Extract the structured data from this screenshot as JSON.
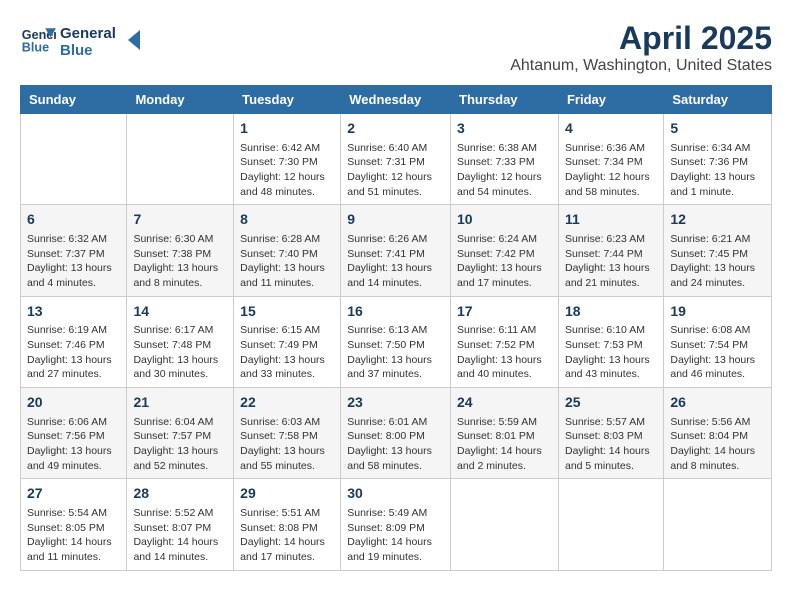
{
  "header": {
    "logo_line1": "General",
    "logo_line2": "Blue",
    "title": "April 2025",
    "subtitle": "Ahtanum, Washington, United States"
  },
  "weekdays": [
    "Sunday",
    "Monday",
    "Tuesday",
    "Wednesday",
    "Thursday",
    "Friday",
    "Saturday"
  ],
  "weeks": [
    [
      {
        "day": "",
        "info": ""
      },
      {
        "day": "",
        "info": ""
      },
      {
        "day": "1",
        "info": "Sunrise: 6:42 AM\nSunset: 7:30 PM\nDaylight: 12 hours\nand 48 minutes."
      },
      {
        "day": "2",
        "info": "Sunrise: 6:40 AM\nSunset: 7:31 PM\nDaylight: 12 hours\nand 51 minutes."
      },
      {
        "day": "3",
        "info": "Sunrise: 6:38 AM\nSunset: 7:33 PM\nDaylight: 12 hours\nand 54 minutes."
      },
      {
        "day": "4",
        "info": "Sunrise: 6:36 AM\nSunset: 7:34 PM\nDaylight: 12 hours\nand 58 minutes."
      },
      {
        "day": "5",
        "info": "Sunrise: 6:34 AM\nSunset: 7:36 PM\nDaylight: 13 hours\nand 1 minute."
      }
    ],
    [
      {
        "day": "6",
        "info": "Sunrise: 6:32 AM\nSunset: 7:37 PM\nDaylight: 13 hours\nand 4 minutes."
      },
      {
        "day": "7",
        "info": "Sunrise: 6:30 AM\nSunset: 7:38 PM\nDaylight: 13 hours\nand 8 minutes."
      },
      {
        "day": "8",
        "info": "Sunrise: 6:28 AM\nSunset: 7:40 PM\nDaylight: 13 hours\nand 11 minutes."
      },
      {
        "day": "9",
        "info": "Sunrise: 6:26 AM\nSunset: 7:41 PM\nDaylight: 13 hours\nand 14 minutes."
      },
      {
        "day": "10",
        "info": "Sunrise: 6:24 AM\nSunset: 7:42 PM\nDaylight: 13 hours\nand 17 minutes."
      },
      {
        "day": "11",
        "info": "Sunrise: 6:23 AM\nSunset: 7:44 PM\nDaylight: 13 hours\nand 21 minutes."
      },
      {
        "day": "12",
        "info": "Sunrise: 6:21 AM\nSunset: 7:45 PM\nDaylight: 13 hours\nand 24 minutes."
      }
    ],
    [
      {
        "day": "13",
        "info": "Sunrise: 6:19 AM\nSunset: 7:46 PM\nDaylight: 13 hours\nand 27 minutes."
      },
      {
        "day": "14",
        "info": "Sunrise: 6:17 AM\nSunset: 7:48 PM\nDaylight: 13 hours\nand 30 minutes."
      },
      {
        "day": "15",
        "info": "Sunrise: 6:15 AM\nSunset: 7:49 PM\nDaylight: 13 hours\nand 33 minutes."
      },
      {
        "day": "16",
        "info": "Sunrise: 6:13 AM\nSunset: 7:50 PM\nDaylight: 13 hours\nand 37 minutes."
      },
      {
        "day": "17",
        "info": "Sunrise: 6:11 AM\nSunset: 7:52 PM\nDaylight: 13 hours\nand 40 minutes."
      },
      {
        "day": "18",
        "info": "Sunrise: 6:10 AM\nSunset: 7:53 PM\nDaylight: 13 hours\nand 43 minutes."
      },
      {
        "day": "19",
        "info": "Sunrise: 6:08 AM\nSunset: 7:54 PM\nDaylight: 13 hours\nand 46 minutes."
      }
    ],
    [
      {
        "day": "20",
        "info": "Sunrise: 6:06 AM\nSunset: 7:56 PM\nDaylight: 13 hours\nand 49 minutes."
      },
      {
        "day": "21",
        "info": "Sunrise: 6:04 AM\nSunset: 7:57 PM\nDaylight: 13 hours\nand 52 minutes."
      },
      {
        "day": "22",
        "info": "Sunrise: 6:03 AM\nSunset: 7:58 PM\nDaylight: 13 hours\nand 55 minutes."
      },
      {
        "day": "23",
        "info": "Sunrise: 6:01 AM\nSunset: 8:00 PM\nDaylight: 13 hours\nand 58 minutes."
      },
      {
        "day": "24",
        "info": "Sunrise: 5:59 AM\nSunset: 8:01 PM\nDaylight: 14 hours\nand 2 minutes."
      },
      {
        "day": "25",
        "info": "Sunrise: 5:57 AM\nSunset: 8:03 PM\nDaylight: 14 hours\nand 5 minutes."
      },
      {
        "day": "26",
        "info": "Sunrise: 5:56 AM\nSunset: 8:04 PM\nDaylight: 14 hours\nand 8 minutes."
      }
    ],
    [
      {
        "day": "27",
        "info": "Sunrise: 5:54 AM\nSunset: 8:05 PM\nDaylight: 14 hours\nand 11 minutes."
      },
      {
        "day": "28",
        "info": "Sunrise: 5:52 AM\nSunset: 8:07 PM\nDaylight: 14 hours\nand 14 minutes."
      },
      {
        "day": "29",
        "info": "Sunrise: 5:51 AM\nSunset: 8:08 PM\nDaylight: 14 hours\nand 17 minutes."
      },
      {
        "day": "30",
        "info": "Sunrise: 5:49 AM\nSunset: 8:09 PM\nDaylight: 14 hours\nand 19 minutes."
      },
      {
        "day": "",
        "info": ""
      },
      {
        "day": "",
        "info": ""
      },
      {
        "day": "",
        "info": ""
      }
    ]
  ]
}
